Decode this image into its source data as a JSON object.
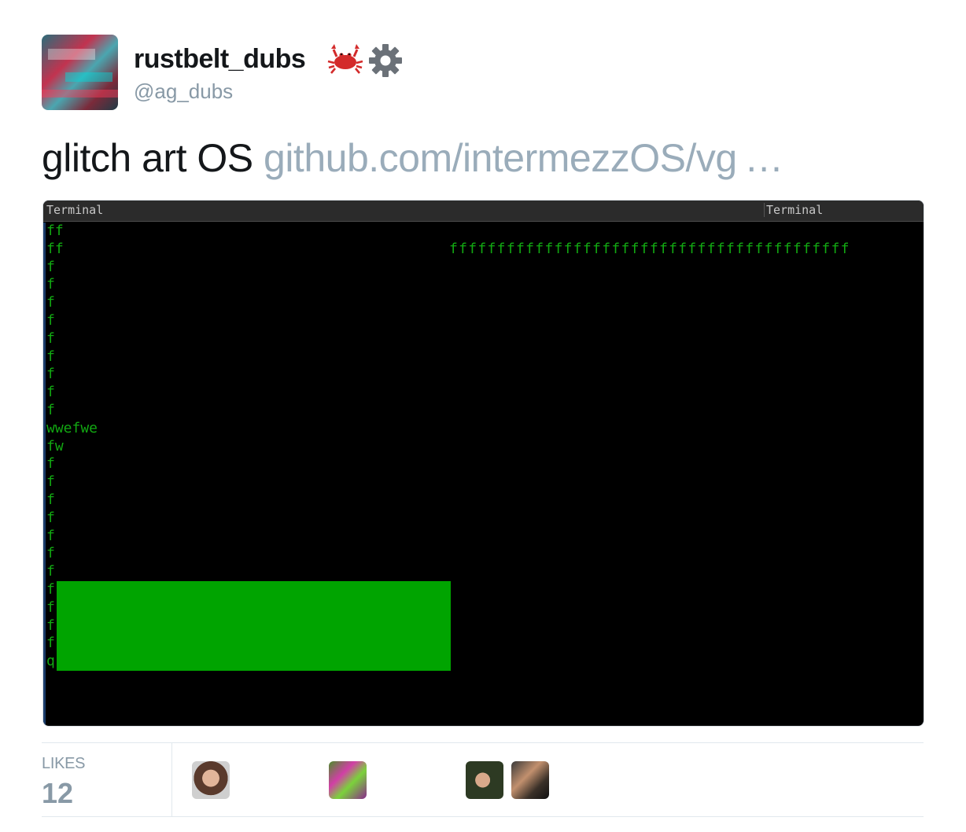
{
  "author": {
    "display_name": "rustbelt_dubs",
    "handle": "@ag_dubs",
    "name_emoji": [
      "crab-icon",
      "gear-icon"
    ]
  },
  "tweet": {
    "text": "glitch art OS",
    "link_text": "github.com/intermezzOS/vg …"
  },
  "terminal": {
    "left_title": "Terminal",
    "right_title": "Terminal",
    "lines": [
      "ff",
      "ff",
      "f",
      "f",
      "f",
      "f",
      "f",
      "f",
      "f",
      "f",
      "f",
      "wwefwe",
      "fw",
      "f",
      "f",
      "f",
      "f",
      "f",
      "f",
      "f",
      "f",
      "f",
      "f",
      "f",
      "q"
    ],
    "right_top_text": "ffffffffffffffffffffffffffffffffffffffffff",
    "colors": {
      "text": "#12a812",
      "block": "#00a400",
      "background": "#000000"
    }
  },
  "footer": {
    "likes_label": "LIKES",
    "likes_count": "12"
  },
  "likers": [
    "avatar",
    "avatar",
    "avatar",
    "avatar"
  ]
}
